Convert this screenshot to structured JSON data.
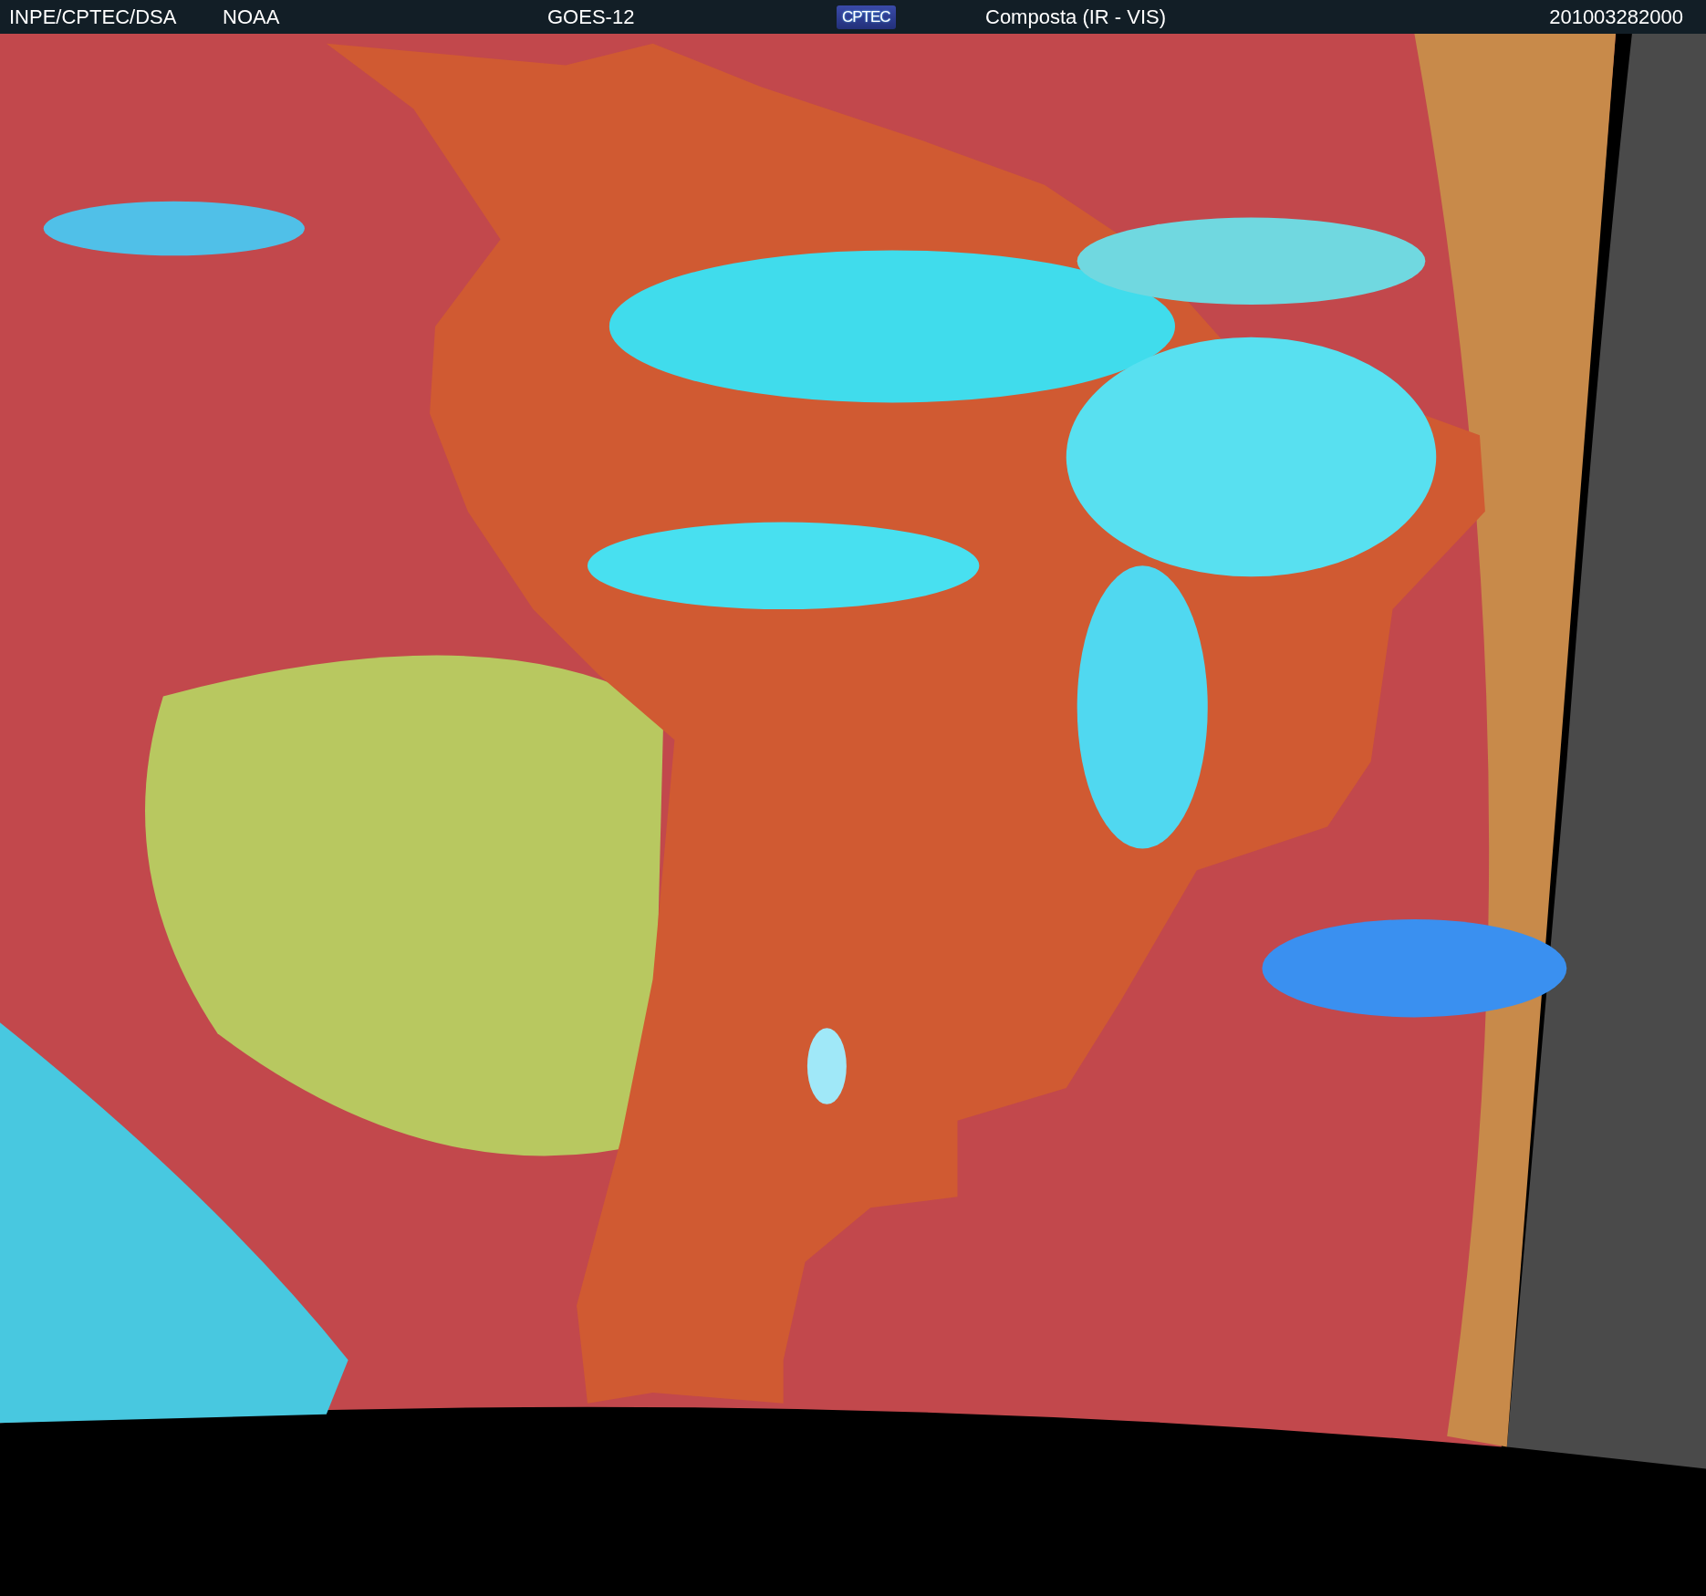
{
  "header": {
    "texts": [
      {
        "kind": "credit",
        "text": "INPE/CPTEC/DSA"
      },
      {
        "kind": "credit",
        "text": "NOAA"
      },
      {
        "kind": "satellite",
        "text": "GOES-12"
      },
      {
        "kind": "logo",
        "text": "CPTEC"
      },
      {
        "kind": "product",
        "text": "Composta (IR - VIS)"
      },
      {
        "kind": "timestamp",
        "text": "201003282000"
      }
    ]
  }
}
